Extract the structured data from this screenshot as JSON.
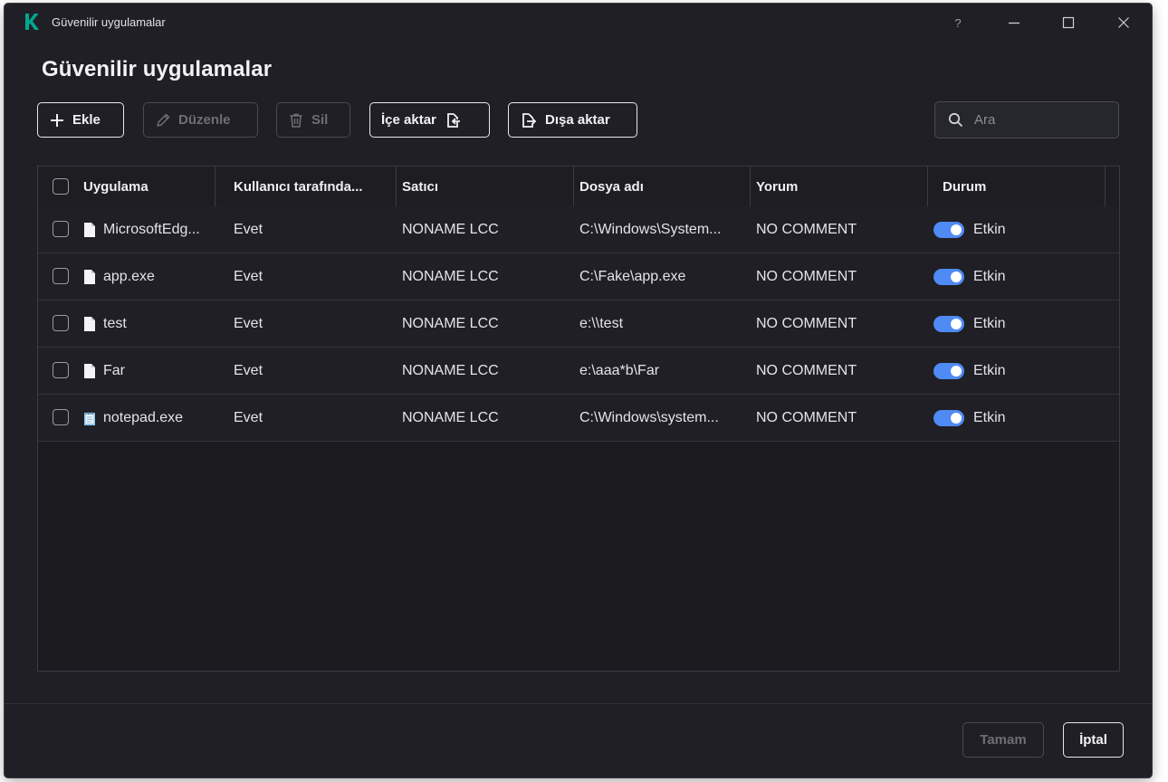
{
  "window": {
    "title": "Güvenilir uygulamalar",
    "help_label": "?"
  },
  "page": {
    "title": "Güvenilir uygulamalar"
  },
  "toolbar": {
    "add_label": "Ekle",
    "edit_label": "Düzenle",
    "delete_label": "Sil",
    "import_label": "İçe aktar",
    "export_label": "Dışa aktar"
  },
  "search": {
    "placeholder": "Ara",
    "value": ""
  },
  "table": {
    "columns": [
      "Uygulama",
      "Kullanıcı tarafında...",
      "Satıcı",
      "Dosya adı",
      "Yorum",
      "Durum"
    ],
    "rows": [
      {
        "app": "MicrosoftEdg...",
        "icon": "file-icon",
        "user": "Evet",
        "vendor": "NONAME LCC",
        "file": "C:\\Windows\\System...",
        "comment": "NO COMMENT",
        "status": "Etkin",
        "enabled": true
      },
      {
        "app": "app.exe",
        "icon": "file-icon",
        "user": "Evet",
        "vendor": "NONAME LCC",
        "file": "C:\\Fake\\app.exe",
        "comment": "NO COMMENT",
        "status": "Etkin",
        "enabled": true
      },
      {
        "app": "test",
        "icon": "file-icon",
        "user": "Evet",
        "vendor": "NONAME LCC",
        "file": "e:\\\\test",
        "comment": "NO COMMENT",
        "status": "Etkin",
        "enabled": true
      },
      {
        "app": "Far",
        "icon": "file-icon",
        "user": "Evet",
        "vendor": "NONAME LCC",
        "file": "e:\\aaa*b\\Far",
        "comment": "NO COMMENT",
        "status": "Etkin",
        "enabled": true
      },
      {
        "app": "notepad.exe",
        "icon": "notepad-icon",
        "user": "Evet",
        "vendor": "NONAME LCC",
        "file": "C:\\Windows\\system...",
        "comment": "NO COMMENT",
        "status": "Etkin",
        "enabled": true
      }
    ]
  },
  "footer": {
    "ok_label": "Tamam",
    "cancel_label": "İptal"
  },
  "colors": {
    "accent": "#4f8af5",
    "background": "#1f1f25",
    "logo": "#00a88e"
  }
}
